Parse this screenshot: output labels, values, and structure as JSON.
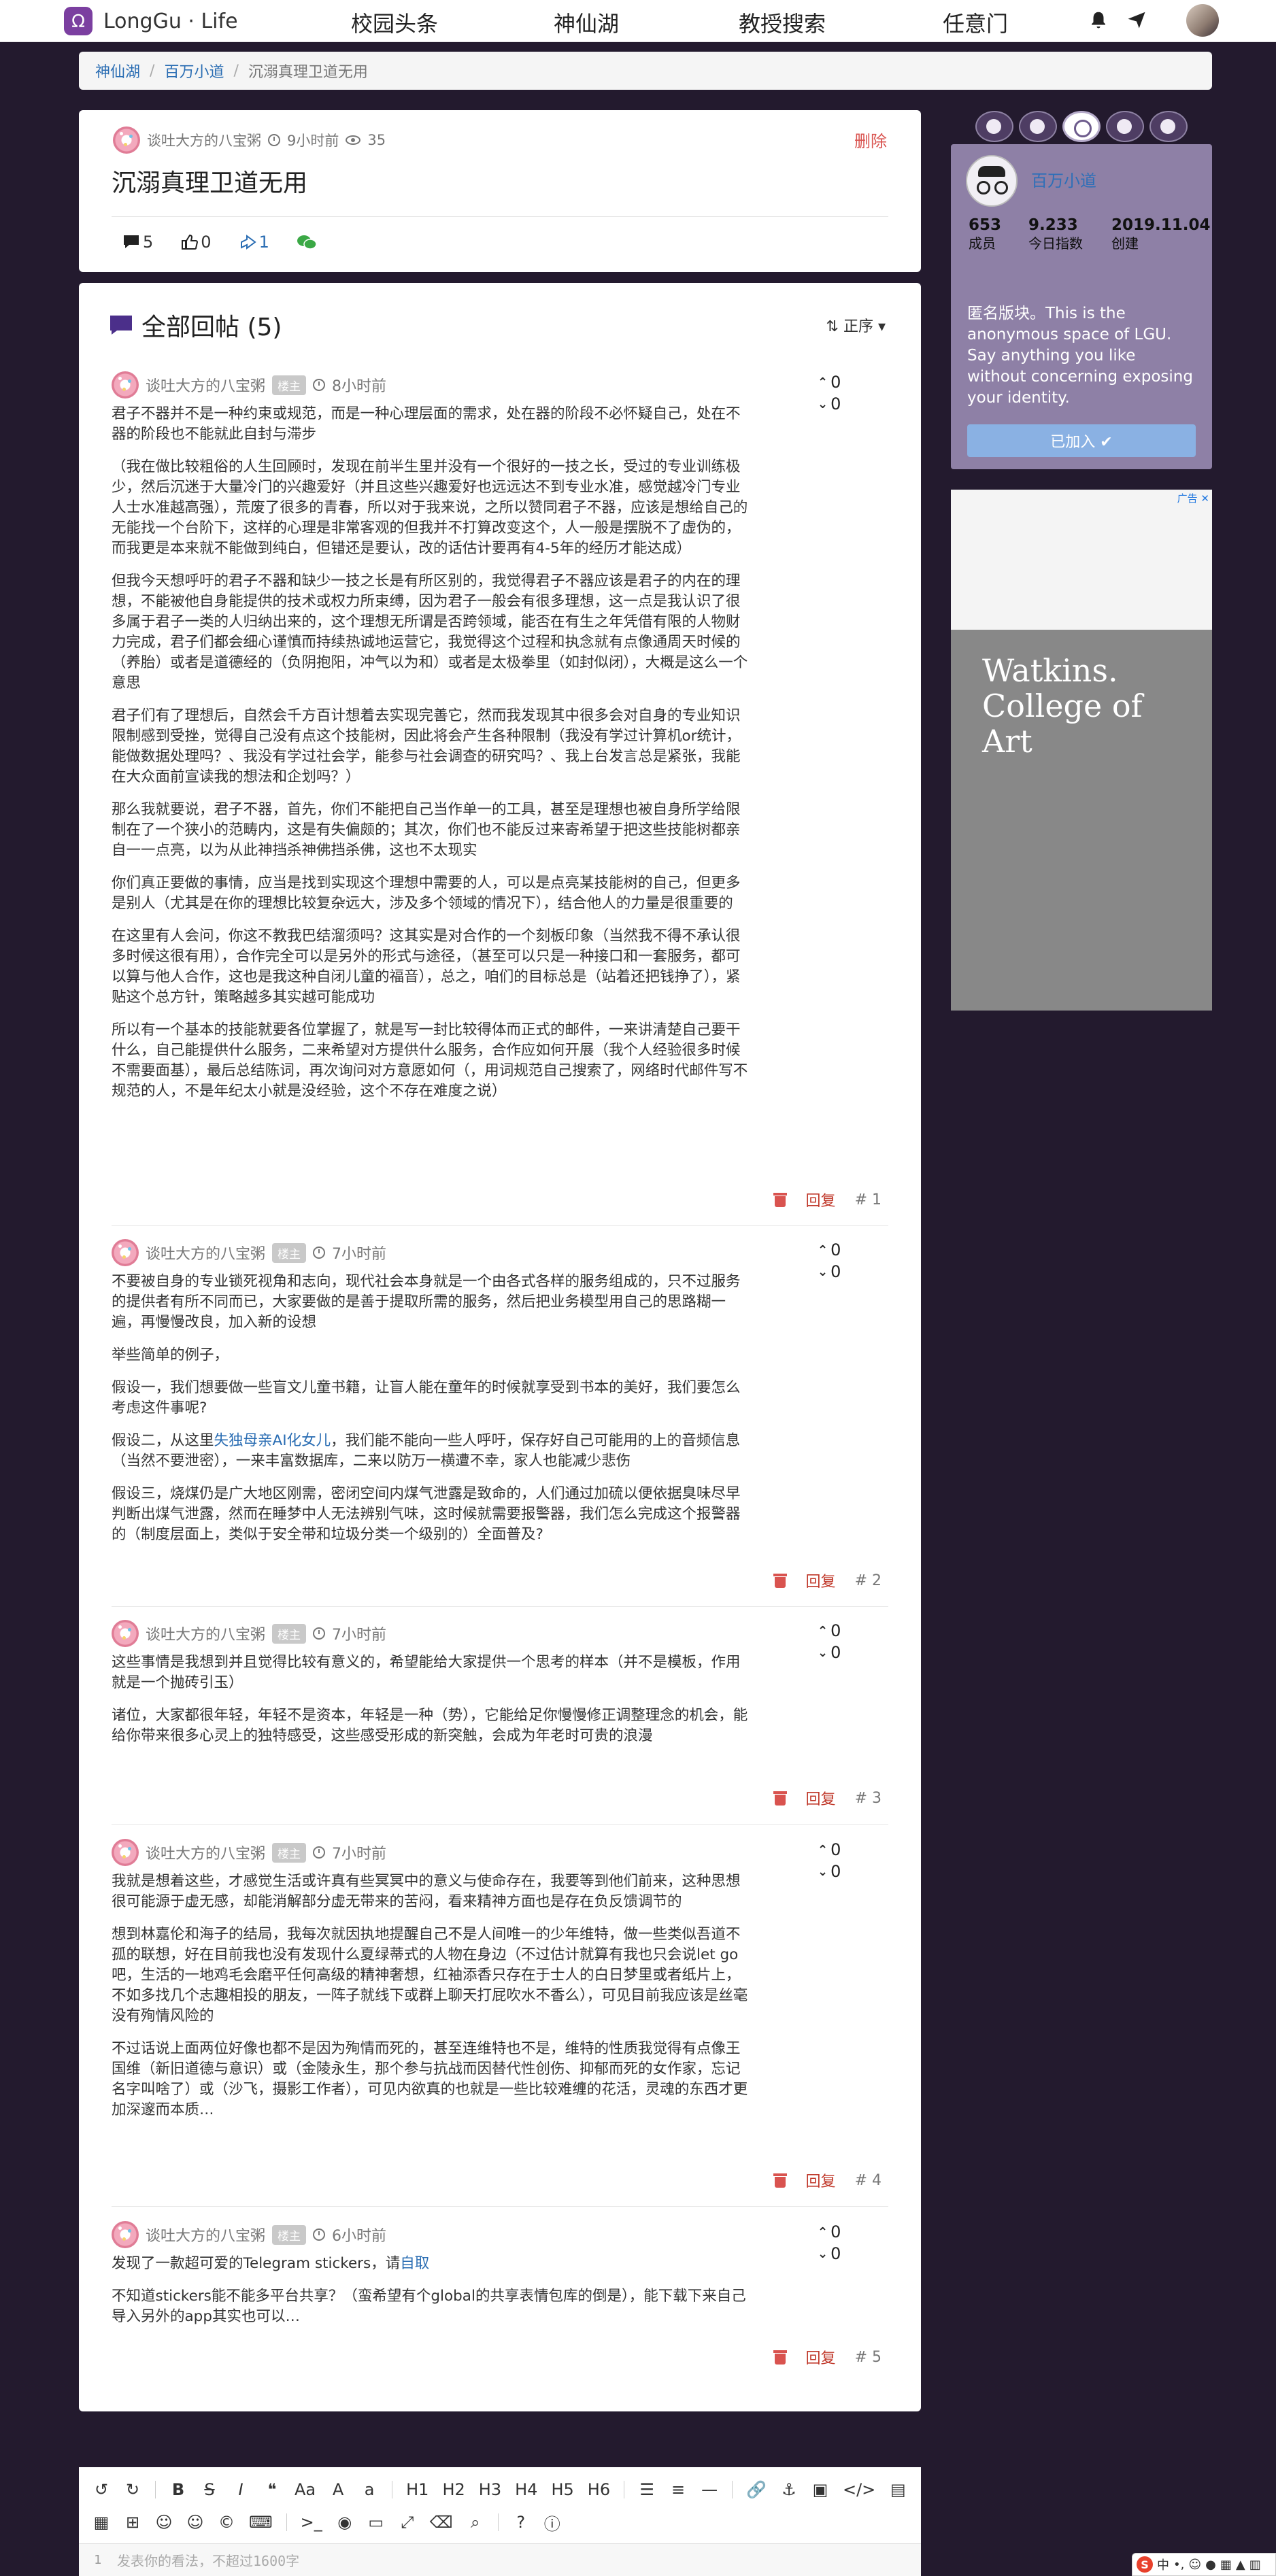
{
  "nav": {
    "brand": "LongGu · Life",
    "links": [
      "校园头条",
      "神仙湖",
      "教授搜索",
      "任意门"
    ]
  },
  "breadcrumb": {
    "items": [
      "神仙湖",
      "百万小道"
    ],
    "current": "沉溺真理卫道无用"
  },
  "post": {
    "author": "谈吐大方的八宝粥",
    "time": "9小时前",
    "views": "35",
    "delete": "删除",
    "title": "沉溺真理卫道无用",
    "comments": "5",
    "likes": "0",
    "shares": "1"
  },
  "replies_header": {
    "title": "全部回帖 (5)",
    "sort": "正序"
  },
  "replies": [
    {
      "author": "谈吐大方的八宝粥",
      "badge": "楼主",
      "time": "8小时前",
      "up": "0",
      "down": "0",
      "reply_label": "回复",
      "floor": "# 1",
      "paragraphs": [
        "君子不器并不是一种约束或规范，而是一种心理层面的需求，处在器的阶段不必怀疑自己，处在不器的阶段也不能就此自封与滞步",
        "（我在做比较粗俗的人生回顾时，发现在前半生里并没有一个很好的一技之长，受过的专业训练极少，然后沉迷于大量冷门的兴趣爱好（并且这些兴趣爱好也远远达不到专业水准，感觉越冷门专业人士水准越高强），荒废了很多的青春，所以对于我来说，之所以赞同君子不器，应该是想给自己的无能找一个台阶下，这样的心理是非常客观的但我并不打算改变这个，人一般是摆脱不了虚伪的，而我更是本来就不能做到纯白，但错还是要认，改的话估计要再有4-5年的经历才能达成）",
        "但我今天想呼吁的君子不器和缺少一技之长是有所区别的，我觉得君子不器应该是君子的内在的理想，不能被他自身能提供的技术或权力所束缚，因为君子一般会有很多理想，这一点是我认识了很多属于君子一类的人归纳出来的，这个理想无所谓是否跨领域，能否在有生之年凭借有限的人物财力完成，君子们都会细心谨慎而持续热诚地运营它，我觉得这个过程和执念就有点像通周天时候的（养胎）或者是道德经的（负阴抱阳，冲气以为和）或者是太极拳里（如封似闭），大概是这么一个意思",
        "君子们有了理想后，自然会千方百计想着去实现完善它，然而我发现其中很多会对自身的专业知识限制感到受挫，觉得自己没有点这个技能树，因此将会产生各种限制（我没有学过计算机or统计，能做数据处理吗？、我没有学过社会学，能参与社会调查的研究吗？、我上台发言总是紧张，我能在大众面前宣读我的想法和企划吗？）",
        "那么我就要说，君子不器，首先，你们不能把自己当作单一的工具，甚至是理想也被自身所学给限制在了一个狭小的范畴内，这是有失偏颇的；其次，你们也不能反过来寄希望于把这些技能树都亲自一一点亮，以为从此神挡杀神佛挡杀佛，这也不太现实",
        "你们真正要做的事情，应当是找到实现这个理想中需要的人，可以是点亮某技能树的自己，但更多是别人（尤其是在你的理想比较复杂远大，涉及多个领域的情况下），结合他人的力量是很重要的",
        "在这里有人会问，你这不教我巴结溜须吗？这其实是对合作的一个刻板印象（当然我不得不承认很多时候这很有用），合作完全可以是另外的形式与途径，（甚至可以只是一种接口和一套服务，都可以算与他人合作，这也是我这种自闭儿童的福音），总之，咱们的目标总是（站着还把钱挣了），紧贴这个总方针，策略越多其实越可能成功",
        "所以有一个基本的技能就要各位掌握了，就是写一封比较得体而正式的邮件，一来讲清楚自己要干什么，自己能提供什么服务，二来希望对方提供什么服务，合作应如何开展（我个人经验很多时候不需要面基），最后总结陈词，再次询问对方意愿如何（，用词规范自己搜索了，网络时代邮件写不规范的人，不是年纪太小就是没经验，这个不存在难度之说）"
      ]
    },
    {
      "author": "谈吐大方的八宝粥",
      "badge": "楼主",
      "time": "7小时前",
      "up": "0",
      "down": "0",
      "reply_label": "回复",
      "floor": "# 2",
      "paragraphs": [
        "不要被自身的专业锁死视角和志向，现代社会本身就是一个由各式各样的服务组成的，只不过服务的提供者有所不同而已，大家要做的是善于提取所需的服务，然后把业务模型用自己的思路糊一遍，再慢慢改良，加入新的设想",
        "举些简单的例子，",
        "假设一，我们想要做一些盲文儿童书籍，让盲人能在童年的时候就享受到书本的美好，我们要怎么考虑这件事呢?"
      ],
      "p4_before": "假设二，从这里",
      "p4_link": "失独母亲AI化女儿",
      "p4_after": "，我们能不能向一些人呼吁，保存好自己可能用的上的音频信息（当然不要泄密），一来丰富数据库，二来以防万一横遭不幸，家人也能减少悲伤",
      "p5": "假设三，烧煤仍是广大地区刚需，密闭空间内煤气泄露是致命的，人们通过加硫以便依据臭味尽早判断出煤气泄露，然而在睡梦中人无法辨别气味，这时候就需要报警器，我们怎么完成这个报警器的（制度层面上，类似于安全带和垃圾分类一个级别的）全面普及?"
    },
    {
      "author": "谈吐大方的八宝粥",
      "badge": "楼主",
      "time": "7小时前",
      "up": "0",
      "down": "0",
      "reply_label": "回复",
      "floor": "# 3",
      "paragraphs": [
        "这些事情是我想到并且觉得比较有意义的，希望能给大家提供一个思考的样本（并不是模板，作用就是一个抛砖引玉）",
        "诸位，大家都很年轻，年轻不是资本，年轻是一种（势），它能给足你慢慢修正调整理念的机会，能给你带来很多心灵上的独特感受，这些感受形成的新突触，会成为年老时可贵的浪漫"
      ]
    },
    {
      "author": "谈吐大方的八宝粥",
      "badge": "楼主",
      "time": "7小时前",
      "up": "0",
      "down": "0",
      "reply_label": "回复",
      "floor": "# 4",
      "paragraphs": [
        "我就是想着这些，才感觉生活或许真有些冥冥中的意义与使命存在，我要等到他们前来，这种思想很可能源于虚无感，却能消解部分虚无带来的苦闷，看来精神方面也是存在负反馈调节的",
        "想到林嘉伦和海子的结局，我每次就因执地提醒自己不是人间唯一的少年维特，做一些类似吾道不孤的联想，好在目前我也没有发现什么夏绿蒂式的人物在身边（不过估计就算有我也只会说let go吧，生活的一地鸡毛会磨平任何高级的精神奢想，红袖添香只存在于士人的白日梦里或者纸片上，不如多找几个志趣相投的朋友，一阵子就线下或群上聊天打屁吹水不香么），可见目前我应该是丝毫没有殉情风险的",
        "不过话说上面两位好像也都不是因为殉情而死的，甚至连维特也不是，维特的性质我觉得有点像王国维（新旧道德与意识）或（金陵永生，那个参与抗战而因替代性创伤、抑郁而死的女作家，忘记名字叫啥了）或（沙飞，摄影工作者），可见内欲真的也就是一些比较难缠的花活，灵魂的东西才更加深邃而本质…"
      ]
    },
    {
      "author": "谈吐大方的八宝粥",
      "badge": "楼主",
      "time": "6小时前",
      "up": "0",
      "down": "0",
      "reply_label": "回复",
      "floor": "# 5",
      "p1_before": "发现了一款超可爱的Telegram stickers，请",
      "p1_link": "自取",
      "p2": "不知道stickers能不能多平台共享？（蛮希望有个global的共享表情包库的倒是），能下载下来自己导入另外的app其实也可以…"
    }
  ],
  "sidebar": {
    "board_name": "百万小道",
    "stats": [
      {
        "num": "653",
        "label": "成员"
      },
      {
        "num": "9.233",
        "label": "今日指数"
      },
      {
        "num": "2019.11.04",
        "label": "创建"
      }
    ],
    "description": "匿名版块。This is the anonymous space of LGU. Say anything you like without concerning exposing your identity.",
    "join_label": "已加入 ✔"
  },
  "ad": {
    "label": "广告 ✕",
    "text": "Watkins. College of Art"
  },
  "editor": {
    "row1": [
      "↺",
      "↻",
      "B",
      "S",
      "I",
      "❝",
      "Aa",
      "A",
      "a",
      "H1",
      "H2",
      "H3",
      "H4",
      "H5",
      "H6",
      "☰",
      "≡",
      "—",
      "🔗",
      "⚓",
      "▣",
      "</>",
      "▤"
    ],
    "row2": [
      "▦",
      "⊞",
      "☺",
      "☺",
      "©",
      "⌨",
      ">_",
      "◉",
      "▭",
      "⤢",
      "⌫",
      "⌕",
      "?",
      "ⓘ"
    ],
    "line_no": "1",
    "placeholder": "发表你的看法，不超过1600字"
  },
  "ime": {
    "logo": "S",
    "mode": "中"
  },
  "colors": {
    "background": "#231a2e",
    "accent_link": "#2a6db3",
    "danger": "#d9534f",
    "board_card": "#8e80a6",
    "join_button": "#8ab1e3"
  }
}
